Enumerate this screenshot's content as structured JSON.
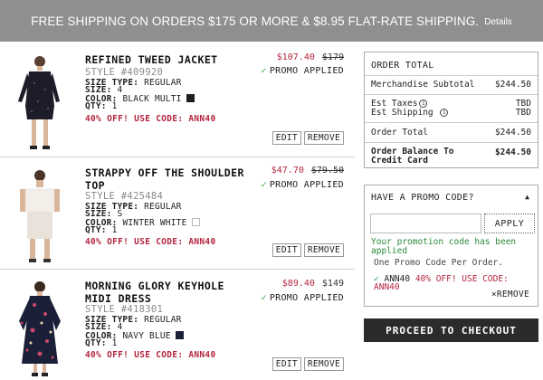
{
  "banner": {
    "text": "FREE SHIPPING ON ORDERS $175 OR MORE & $8.95 FLAT-RATE SHIPPING.",
    "details": "Details"
  },
  "items": [
    {
      "name": "REFINED TWEED JACKET",
      "style": "STYLE #409920",
      "size_type_label": "SIZE TYPE:",
      "size_type": "REGULAR",
      "size_label": "SIZE:",
      "size": "4",
      "color_label": "COLOR:",
      "color": "BLACK MULTI",
      "qty_label": "QTY:",
      "qty": "1",
      "promo": "40% OFF! USE CODE: ANN40",
      "sale_price": "$107.40",
      "orig_price": "$179",
      "applied": "PROMO APPLIED",
      "edit": "EDIT",
      "remove": "REMOVE",
      "swatch_color": "#1f1f1f"
    },
    {
      "name": "STRAPPY OFF THE SHOULDER TOP",
      "style": "STYLE #425484",
      "size_type_label": "SIZE TYPE:",
      "size_type": "REGULAR",
      "size_label": "SIZE:",
      "size": "S",
      "color_label": "COLOR:",
      "color": "WINTER WHITE",
      "qty_label": "QTY:",
      "qty": "1",
      "promo": "40% OFF! USE CODE: ANN40",
      "sale_price": "$47.70",
      "orig_price": "$79.50",
      "applied": "PROMO APPLIED",
      "edit": "EDIT",
      "remove": "REMOVE",
      "swatch_color": "#ffffff"
    },
    {
      "name": "MORNING GLORY KEYHOLE MIDI DRESS",
      "style": "STYLE #418301",
      "size_type_label": "SIZE TYPE:",
      "size_type": "REGULAR",
      "size_label": "SIZE:",
      "size": "4",
      "color_label": "COLOR:",
      "color": "NAVY BLUE",
      "qty_label": "QTY:",
      "qty": "1",
      "promo": "40% OFF! USE CODE: ANN40",
      "sale_price": "$89.40",
      "orig_price": "$149",
      "applied": "PROMO APPLIED",
      "edit": "EDIT",
      "remove": "REMOVE",
      "swatch_color": "#1c1f38"
    }
  ],
  "order": {
    "title": "ORDER TOTAL",
    "merch_label": "Merchandise Subtotal",
    "merch_value": "$244.50",
    "tax_label": "Est Taxes",
    "tax_value": "TBD",
    "ship_label": "Est Shipping",
    "ship_value": "TBD",
    "total_label": "Order Total",
    "total_value": "$244.50",
    "balance_label_1": "Order Balance To",
    "balance_label_2": "Credit Card",
    "balance_value": "$244.50"
  },
  "promo_code": {
    "title": "HAVE A PROMO CODE?",
    "caret": "▲",
    "input_value": "",
    "apply": "APPLY",
    "success": "Your promotion code has been applied",
    "once": "One Promo Code Per Order.",
    "code": "ANN40",
    "code_msg": "40% OFF! USE CODE: ANN40",
    "remove": "REMOVE"
  },
  "checkout": "PROCEED TO CHECKOUT",
  "colors": {
    "banner": "#8f8f8f",
    "sale": "#b3263f",
    "success": "#2a8a3a",
    "checkout": "#2b2b2b"
  }
}
